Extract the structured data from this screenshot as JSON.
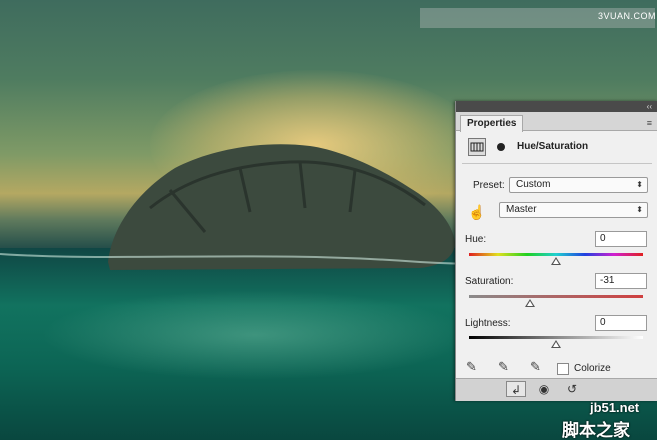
{
  "watermark": {
    "top": "3VUAN.COM",
    "site": "jb51.net",
    "site_cn": "脚本之家"
  },
  "panel": {
    "tab": "Properties",
    "collapse_glyph": "‹‹",
    "menu_glyph": "≡",
    "adjustment_title": "Hue/Saturation",
    "preset_label": "Preset:",
    "preset_value": "Custom",
    "channel_value": "Master",
    "hue_label": "Hue:",
    "hue_value": "0",
    "saturation_label": "Saturation:",
    "saturation_value": "-31",
    "lightness_label": "Lightness:",
    "lightness_value": "0",
    "colorize_label": "Colorize",
    "colorize_checked": false,
    "hue_position": 0.5,
    "saturation_position": 0.35,
    "lightness_position": 0.5,
    "footer_icons": [
      "clip-to-layer-icon",
      "visibility-icon",
      "reset-icon"
    ]
  }
}
